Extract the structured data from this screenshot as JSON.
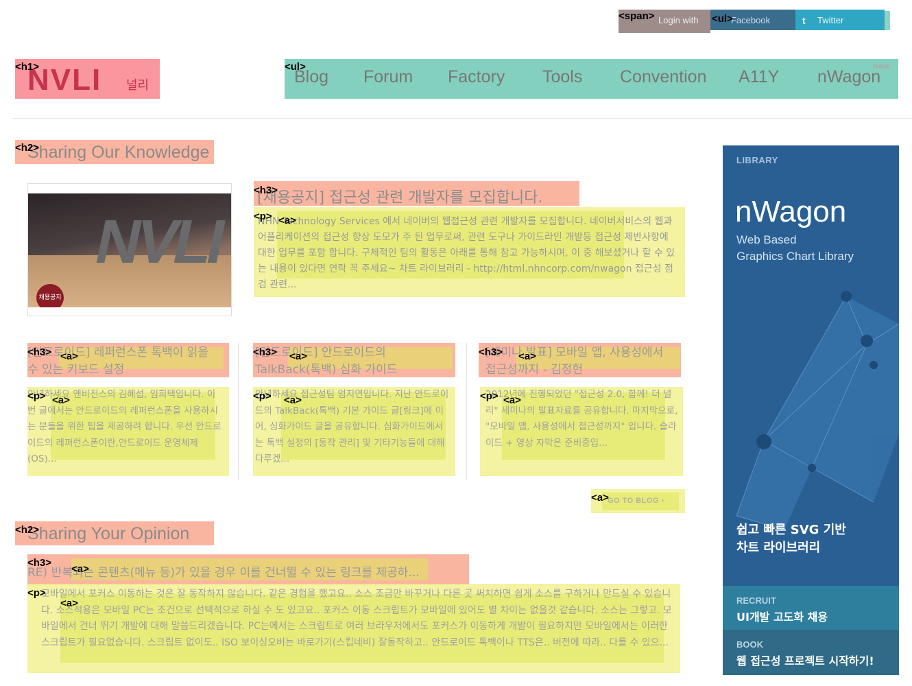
{
  "login": {
    "label": "Login with",
    "facebook": "Facebook",
    "twitter": "Twitter",
    "twitter_icon": "t"
  },
  "logo": {
    "mark": "NVLI",
    "korean": "널리"
  },
  "nav": {
    "items": [
      "Blog",
      "Forum",
      "Factory",
      "Tools",
      "Convention",
      "A11Y",
      "nWagon"
    ],
    "new_badge": "new"
  },
  "sharing_knowledge": {
    "title": "Sharing Our Knowledge",
    "thumb_badge": "채용공지",
    "featured": {
      "title": "[채용공지] 접근성 관련 개발자를 모집합니다.",
      "body": "NHN Technology Services 에서 네이버의 웹접근성 관련 개발자를 모집합니다. 네이버서비스의 웹과 어플리케이션의 접근성 향상 도모가 주 된 업무로써, 관련 도구나 가이드라인 개발등 접근성 제반사항에 대한 업무를 포함 합니다. 구체적인 팀의 활동은 아래를 통해 참고 가능하시며, 이 중 해보셨거나 할 수 있는 내용이 있다면 연락 꼭 주세요~ 차트 라이브러리 - http://html.nhncorp.com/nwagon 접근성 점검 관련..."
    },
    "columns": [
      {
        "title": "[안드로이드] 레퍼런스폰 톡백이 읽을 수 있는 키보드 설정",
        "body": "안녕하세요 엔비전스의 김혜섭, 임희택입니다. 이번 글에서는 안드로이드의 레퍼런스폰을 사용하시는 분들을 위한 팁을 제공하려 합니다. 우선 안드로이드의 레퍼런스폰이란,안드로이드 운영체제(OS)..."
      },
      {
        "title": "[안드로이드] 안드로이드의 TalkBack(톡백) 심화 가이드",
        "body": "안녕하세요 접근성팀 엄지연입니다. 지난 안드로이드의 TalkBack(톡백) 기본 가이드 글[링크]에 이어, 심화가이드 글을 공유합니다. 심화가이드에서는 톡백 설정의 [동작 관리] 및 기타기능들에 대해 다루겠..."
      },
      {
        "title": "[세미나 발표] 모바일 앱, 사용성에서 접근성까지 - 김정헌",
        "body": "2012년에 진행되었던 \"접근성 2.0, 함께! 더 널리\" 세미나의 발표자료를 공유합니다. 마지막으로, \"모바일 앱, 사용성에서 접근성까지\" 입니다. 슬라이드 + 영상 자막은 준비중입..."
      }
    ],
    "go_to_blog": "GO TO BLOG ›"
  },
  "sharing_opinion": {
    "title": "Sharing Your Opinion",
    "post_title": "RE) 반복되는 콘텐츠(메뉴 등)가 있을 경우 이를 건너뛸 수 있는 링크를 제공하...",
    "post_body": "모바일에서 포커스 이동하는 것은 잘 동작하지 않습니다. 같은 경험을 했고요.. 소스 조금만 바꾸거나 다른 곳 써치하면 쉽게 소스를 구하거나 만드실 수 있습니다. 소스적용은 모바일 PC는 조건으로 선택적으로 하실 수 도 있고요.. 포커스 이동 스크립트가 모바일에 있어도 별 차이는 없을것 같습니다. 소스는 그렇고. 모바일에서 건너 뛰기 개발에 대해 말씀드리겠습니다. PC는에서는 스크립트로 여러 브라우저에서도 포커스가 이동하게 개발이 필요하지만 모바일에서는 이러한 스크립트가 필요없습니다. 스크립트 없이도.. ISO 보이싱오버는 바로가기(스킵네비) 잘동작하고.. 안드로이드 톡백이나 TTS은.. 버전에 따라.. 다를 수 있으..."
  },
  "sidebar": {
    "library_label": "LIBRARY",
    "product": "nWagon",
    "product_sub_1": "Web Based",
    "product_sub_2": "Graphics Chart Library",
    "promo_1": "쉽고 빠른 SVG 기반",
    "promo_2": "차트 라이브러리",
    "recruit_label": "RECRUIT",
    "recruit_text": "UI개발 고도화 채용",
    "book_label": "BOOK",
    "book_text": "웹 접근성 프로젝트 시작하기!"
  },
  "overlay_tags": {
    "span": "<span>",
    "ul": "<ul>",
    "h1": "<h1>",
    "h2": "<h2>",
    "h3": "<h3>",
    "p": "<p>",
    "a": "<a>"
  },
  "colors": {
    "sidebar_bg": "#2a5f94",
    "recruit_bg": "#2d7f9d",
    "book_bg": "#2f6a86",
    "twitter": "#2fa7c4",
    "facebook": "#3a6d8c"
  }
}
